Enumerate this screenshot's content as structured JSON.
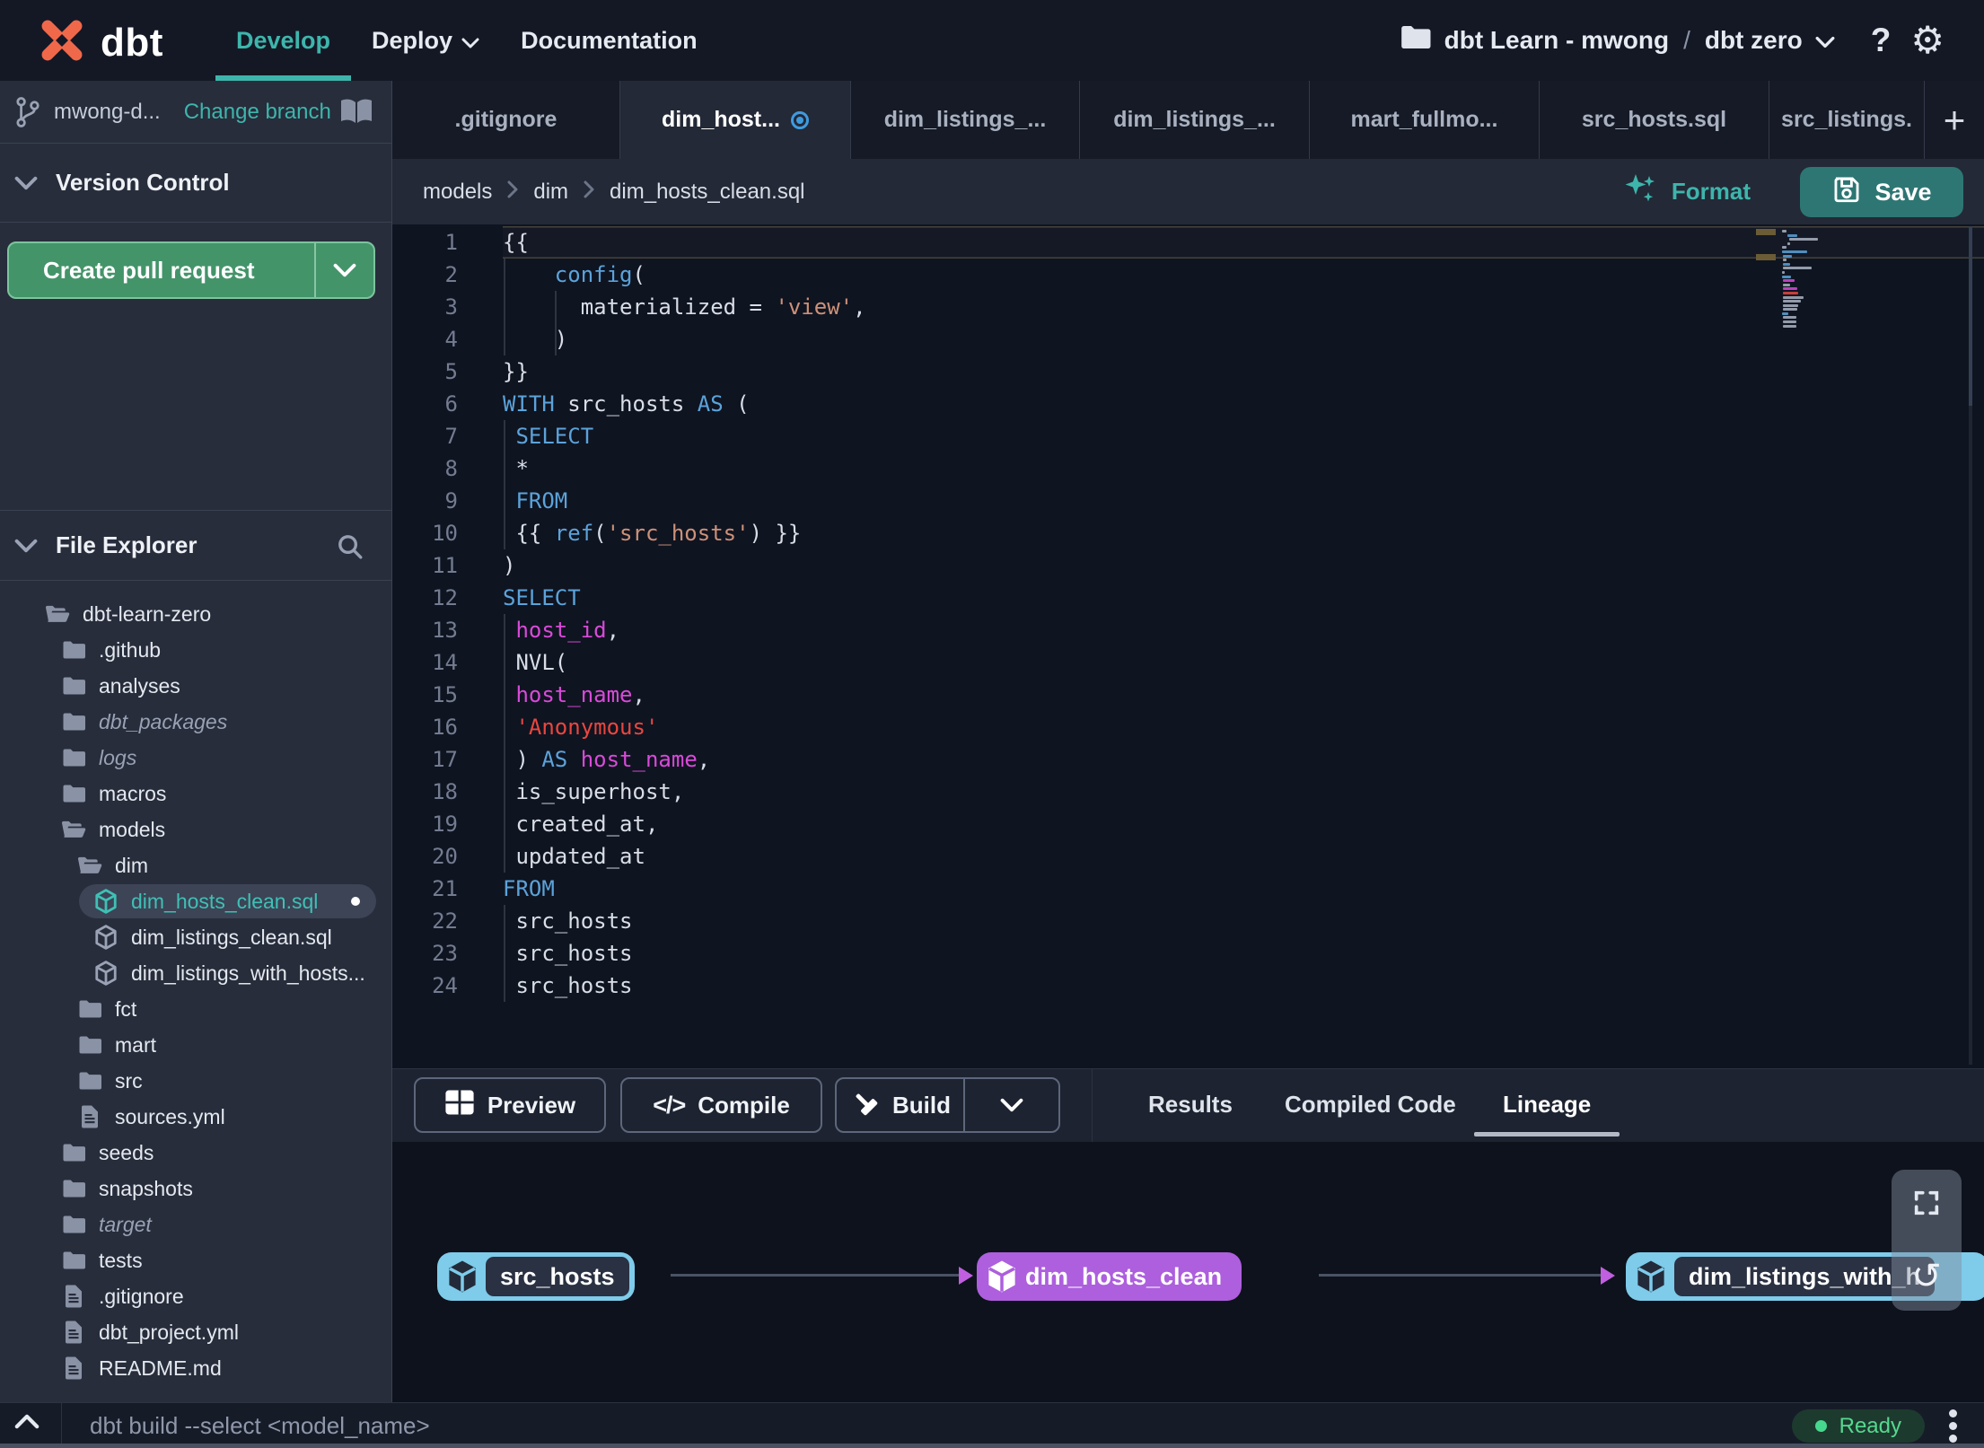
{
  "colors": {
    "accent": "#3eb5ac",
    "save_button": "#2d7673",
    "pr_button": "#44946a",
    "ready": "#55d98f",
    "logo": "#f0684a",
    "node_blue": "#7ecbea",
    "node_purple": "#ad5fdd",
    "tab_modified": "#3f9be0",
    "syntax_keyword": "#5ba3da",
    "syntax_string": "#cd9178",
    "syntax_string_red": "#e8473f",
    "syntax_identifier": "#d94ad9",
    "syntax_text": "#d8dde6"
  },
  "nav": {
    "brand": "dbt",
    "items": [
      {
        "label": "Develop",
        "active": true
      },
      {
        "label": "Deploy",
        "caret": true
      },
      {
        "label": "Documentation"
      }
    ],
    "project": {
      "name": "dbt Learn - mwong",
      "separator": "/",
      "environment": "dbt zero"
    }
  },
  "sidebar": {
    "branch": {
      "name": "mwong-d...",
      "change_label": "Change branch"
    },
    "version_control": {
      "title": "Version Control",
      "create_pr_label": "Create pull request"
    },
    "file_explorer": {
      "title": "File Explorer"
    },
    "tree": [
      {
        "name": "dbt-learn-zero",
        "icon": "folder-open",
        "depth": 0
      },
      {
        "name": ".github",
        "icon": "folder",
        "depth": 1
      },
      {
        "name": "analyses",
        "icon": "folder",
        "depth": 1
      },
      {
        "name": "dbt_packages",
        "icon": "folder",
        "depth": 1,
        "italic": true
      },
      {
        "name": "logs",
        "icon": "folder",
        "depth": 1,
        "italic": true
      },
      {
        "name": "macros",
        "icon": "folder",
        "depth": 1
      },
      {
        "name": "models",
        "icon": "folder-open",
        "depth": 1
      },
      {
        "name": "dim",
        "icon": "folder-open",
        "depth": 2
      },
      {
        "name": "dim_hosts_clean.sql",
        "icon": "model",
        "depth": 3,
        "selected": true,
        "modified": true
      },
      {
        "name": "dim_listings_clean.sql",
        "icon": "model",
        "depth": 3
      },
      {
        "name": "dim_listings_with_hosts...",
        "icon": "model",
        "depth": 3
      },
      {
        "name": "fct",
        "icon": "folder",
        "depth": 2
      },
      {
        "name": "mart",
        "icon": "folder",
        "depth": 2
      },
      {
        "name": "src",
        "icon": "folder",
        "depth": 2
      },
      {
        "name": "sources.yml",
        "icon": "file",
        "depth": 2
      },
      {
        "name": "seeds",
        "icon": "folder",
        "depth": 1
      },
      {
        "name": "snapshots",
        "icon": "folder",
        "depth": 1
      },
      {
        "name": "target",
        "icon": "folder",
        "depth": 1,
        "italic": true
      },
      {
        "name": "tests",
        "icon": "folder",
        "depth": 1
      },
      {
        "name": ".gitignore",
        "icon": "file",
        "depth": 1
      },
      {
        "name": "dbt_project.yml",
        "icon": "file",
        "depth": 1
      },
      {
        "name": "README.md",
        "icon": "file",
        "depth": 1
      }
    ]
  },
  "tabs": [
    {
      "label": ".gitignore"
    },
    {
      "label": "dim_host...",
      "active": true,
      "modified": true
    },
    {
      "label": "dim_listings_..."
    },
    {
      "label": "dim_listings_..."
    },
    {
      "label": "mart_fullmo..."
    },
    {
      "label": "src_hosts.sql"
    },
    {
      "label": "src_listings."
    }
  ],
  "editor": {
    "breadcrumb": [
      "models",
      "dim",
      "dim_hosts_clean.sql"
    ],
    "format_label": "Format",
    "save_label": "Save",
    "lines": [
      {
        "n": 1,
        "current": true,
        "tokens": [
          [
            "{{",
            "pl"
          ]
        ]
      },
      {
        "n": 2,
        "tokens": [
          [
            "    ",
            "pl"
          ],
          [
            "config",
            "kw"
          ],
          [
            "(",
            "pl"
          ]
        ]
      },
      {
        "n": 3,
        "tokens": [
          [
            "      materialized = ",
            "pl"
          ],
          [
            "'view'",
            "st"
          ],
          [
            ",",
            "pl"
          ]
        ]
      },
      {
        "n": 4,
        "tokens": [
          [
            "    )",
            "pl"
          ]
        ]
      },
      {
        "n": 5,
        "tokens": [
          [
            "}}",
            "pl"
          ]
        ]
      },
      {
        "n": 6,
        "tokens": [
          [
            "WITH",
            "kw"
          ],
          [
            " src_hosts ",
            "pl"
          ],
          [
            "AS",
            "kw"
          ],
          [
            " (",
            "pl"
          ]
        ]
      },
      {
        "n": 7,
        "tokens": [
          [
            " ",
            "pl"
          ],
          [
            "SELECT",
            "kw"
          ]
        ]
      },
      {
        "n": 8,
        "tokens": [
          [
            " *",
            "pl"
          ]
        ]
      },
      {
        "n": 9,
        "tokens": [
          [
            " ",
            "pl"
          ],
          [
            "FROM",
            "kw"
          ]
        ]
      },
      {
        "n": 10,
        "tokens": [
          [
            " {{ ",
            "pl"
          ],
          [
            "ref",
            "kw"
          ],
          [
            "(",
            "pl"
          ],
          [
            "'src_hosts'",
            "st"
          ],
          [
            ") }}",
            "pl"
          ]
        ]
      },
      {
        "n": 11,
        "tokens": [
          [
            ")",
            "pl"
          ]
        ]
      },
      {
        "n": 12,
        "tokens": [
          [
            "SELECT",
            "kw"
          ]
        ]
      },
      {
        "n": 13,
        "tokens": [
          [
            " ",
            "pl"
          ],
          [
            "host_id",
            "id"
          ],
          [
            ",",
            "pl"
          ]
        ]
      },
      {
        "n": 14,
        "tokens": [
          [
            " NVL(",
            "pl"
          ]
        ]
      },
      {
        "n": 15,
        "tokens": [
          [
            " ",
            "pl"
          ],
          [
            "host_name",
            "id"
          ],
          [
            ",",
            "pl"
          ]
        ]
      },
      {
        "n": 16,
        "tokens": [
          [
            " ",
            "pl"
          ],
          [
            "'Anonymous'",
            "sr"
          ]
        ]
      },
      {
        "n": 17,
        "tokens": [
          [
            " ) ",
            "pl"
          ],
          [
            "AS",
            "kw"
          ],
          [
            " ",
            "pl"
          ],
          [
            "host_name",
            "id"
          ],
          [
            ",",
            "pl"
          ]
        ]
      },
      {
        "n": 18,
        "tokens": [
          [
            " is_superhost,",
            "pl"
          ]
        ]
      },
      {
        "n": 19,
        "tokens": [
          [
            " created_at,",
            "pl"
          ]
        ]
      },
      {
        "n": 20,
        "tokens": [
          [
            " updated_at",
            "pl"
          ]
        ]
      },
      {
        "n": 21,
        "tokens": [
          [
            "FROM",
            "kw"
          ]
        ]
      },
      {
        "n": 22,
        "tokens": [
          [
            " src_hosts",
            "pl"
          ]
        ]
      },
      {
        "n": 23,
        "tokens": [
          [
            " src_hosts",
            "pl"
          ]
        ]
      },
      {
        "n": 24,
        "tokens": [
          [
            " src_hosts",
            "pl"
          ]
        ]
      }
    ]
  },
  "panel": {
    "buttons": [
      {
        "label": "Preview",
        "icon": "grid"
      },
      {
        "label": "Compile",
        "icon": "code"
      },
      {
        "label": "Build",
        "icon": "hammer",
        "split": true
      }
    ],
    "tabs": [
      {
        "label": "Results"
      },
      {
        "label": "Compiled Code"
      },
      {
        "label": "Lineage",
        "active": true
      }
    ]
  },
  "lineage": {
    "nodes": [
      {
        "label": "src_hosts",
        "style": "blue"
      },
      {
        "label": "dim_hosts_clean",
        "style": "purple"
      },
      {
        "label": "dim_listings_with_h",
        "style": "blue"
      }
    ]
  },
  "statusbar": {
    "command": "dbt build --select <model_name>",
    "ready_label": "Ready"
  }
}
